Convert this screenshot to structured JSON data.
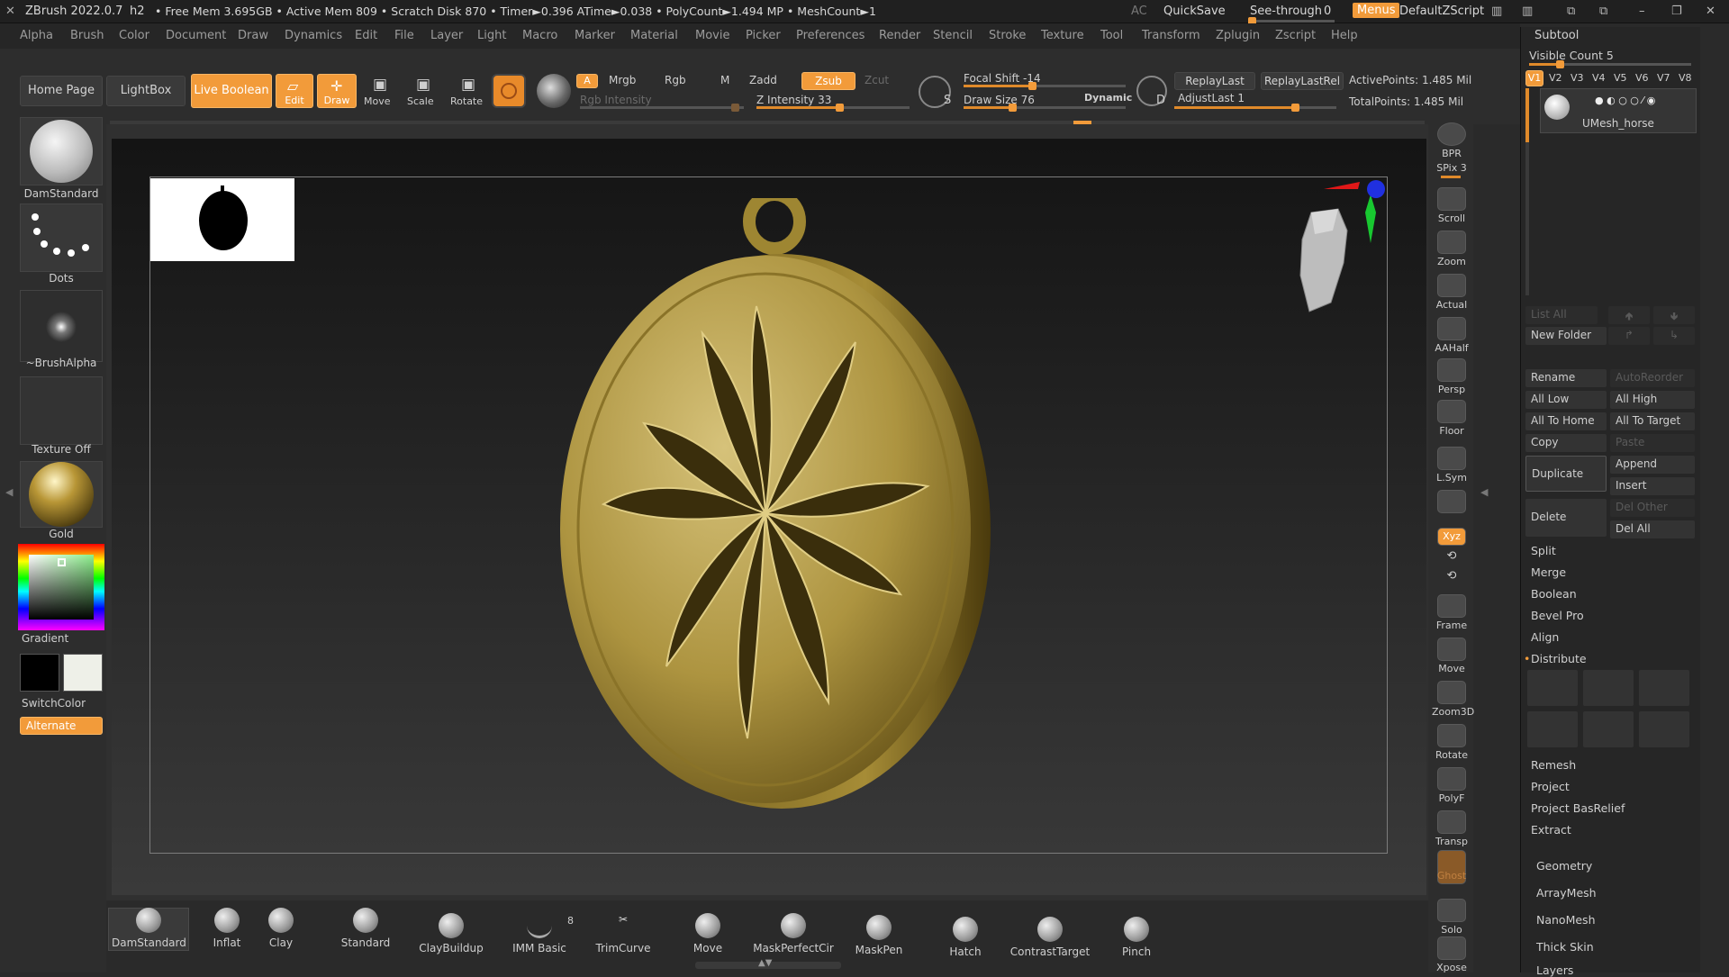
{
  "title_bar": {
    "app": "ZBrush 2022.0.7",
    "doc": "h2",
    "stats": "• Free Mem 3.695GB • Active Mem 809 • Scratch Disk 870 • Timer►0.396 ATime►0.038 • PolyCount►1.494 MP • MeshCount►1",
    "ac": "AC",
    "quicksave": "QuickSave",
    "see_through_label": "See-through",
    "see_through_value": "0",
    "see_through_level": 0,
    "menus": "Menus",
    "script": "DefaultZScript"
  },
  "menu": [
    "Alpha",
    "Brush",
    "Color",
    "Document",
    "Draw",
    "Dynamics",
    "Edit",
    "File",
    "Layer",
    "Light",
    "Macro",
    "Marker",
    "Material",
    "Movie",
    "Picker",
    "Preferences",
    "Render",
    "Stencil",
    "Stroke",
    "Texture",
    "Tool",
    "Transform",
    "Zplugin",
    "Zscript",
    "Help"
  ],
  "shelf": {
    "home": "Home Page",
    "lightbox": "LightBox",
    "live_boolean": "Live Boolean",
    "edit": "Edit",
    "draw": "Draw",
    "move": "Move",
    "scale": "Scale",
    "rotate": "Rotate",
    "a": "A",
    "mrgb": "Mrgb",
    "rgb": "Rgb",
    "m": "M",
    "zadd": "Zadd",
    "zsub": "Zsub",
    "zcut": "Zcut",
    "rgb_intensity": "Rgb Intensity",
    "z_intensity": "Z Intensity 33",
    "focal_shift": "Focal Shift -14",
    "draw_size": "Draw Size 76",
    "dynamic": "Dynamic",
    "replay_last": "ReplayLast",
    "replay_last_rel": "ReplayLastRel",
    "adjust_last": "AdjustLast 1",
    "active_points": "ActivePoints: 1.485 Mil",
    "total_points": "TotalPoints: 1.485 Mil",
    "s_key": "S",
    "d_key": "D"
  },
  "left": {
    "brush": "DamStandard",
    "stroke": "Dots",
    "alpha": "~BrushAlpha",
    "texture": "Texture Off",
    "material": "Gold",
    "gradient": "Gradient",
    "switch_color": "SwitchColor",
    "alternate": "Alternate"
  },
  "right_strip": [
    "BPR",
    "SPix 3",
    "Scroll",
    "Zoom",
    "Actual",
    "AAHalf",
    "Persp",
    "Floor",
    "L.Sym",
    "",
    "Xyz",
    "",
    "",
    "Frame",
    "Move",
    "Zoom3D",
    "Rotate",
    "PolyF",
    "Transp",
    "Ghost",
    "Solo",
    "Xpose"
  ],
  "subtool": {
    "title": "Subtool",
    "visible_count": "Visible Count 5",
    "versions": [
      "V1",
      "V2",
      "V3",
      "V4",
      "V5",
      "V6",
      "V7",
      "V8"
    ],
    "mesh_name": "UMesh_horse",
    "list_all": "List All",
    "new_folder": "New Folder",
    "rename": "Rename",
    "auto_reorder": "AutoReorder",
    "all_low": "All Low",
    "all_high": "All High",
    "all_to_home": "All To Home",
    "all_to_target": "All To Target",
    "copy": "Copy",
    "paste": "Paste",
    "duplicate": "Duplicate",
    "append": "Append",
    "insert": "Insert",
    "delete": "Delete",
    "del_other": "Del Other",
    "del_all": "Del All",
    "sections": [
      "Split",
      "Merge",
      "Boolean",
      "Bevel Pro",
      "Align",
      "Distribute"
    ],
    "sections2": [
      "Remesh",
      "Project",
      "Project BasRelief",
      "Extract"
    ],
    "groups": [
      "Geometry",
      "ArrayMesh",
      "NanoMesh",
      "Thick Skin",
      "Layers"
    ]
  },
  "bottom_brushes": [
    "DamStandard",
    "Inflat",
    "Clay",
    "Standard",
    "ClayBuildup",
    "IMM Basic",
    "TrimCurve",
    "Move",
    "MaskPerfectCir",
    "MaskPen",
    "Hatch",
    "ContrastTarget",
    "Pinch"
  ],
  "imm_count": "8",
  "colors": {
    "accent": "#f29b3a",
    "gold": "#b8a046",
    "bg": "#2a2a2a"
  }
}
